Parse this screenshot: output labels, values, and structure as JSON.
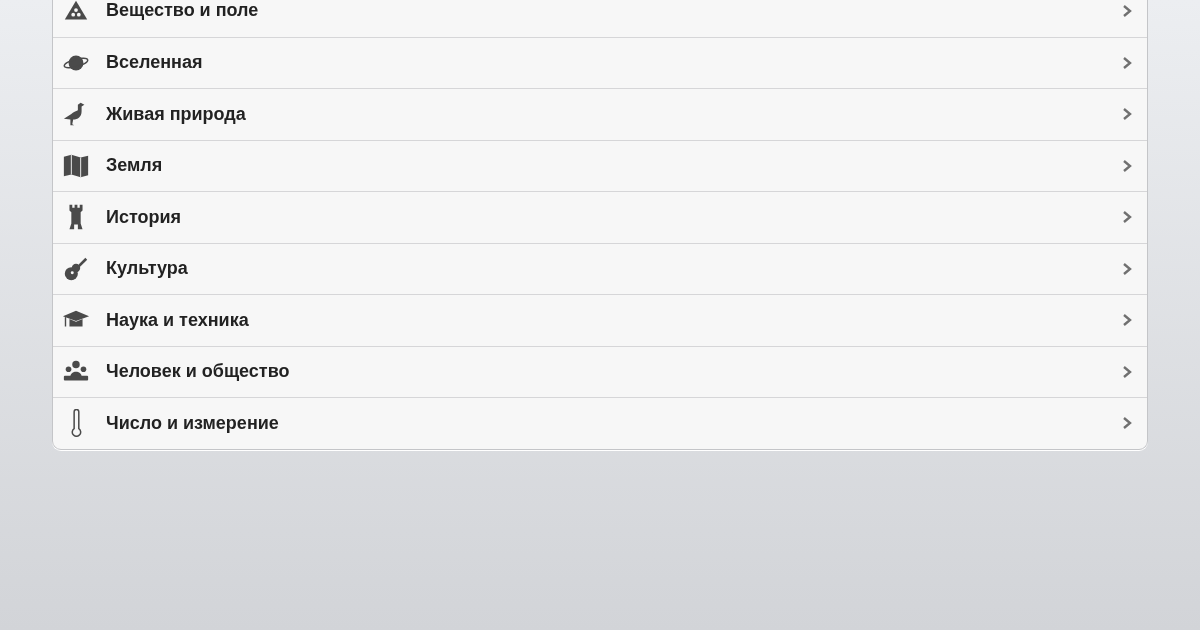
{
  "categories": [
    {
      "label": "Вещество и поле"
    },
    {
      "label": "Вселенная"
    },
    {
      "label": "Живая природа"
    },
    {
      "label": "Земля"
    },
    {
      "label": "История"
    },
    {
      "label": "Культура"
    },
    {
      "label": "Наука и техника"
    },
    {
      "label": "Человек и общество"
    },
    {
      "label": "Число и измерение"
    }
  ]
}
